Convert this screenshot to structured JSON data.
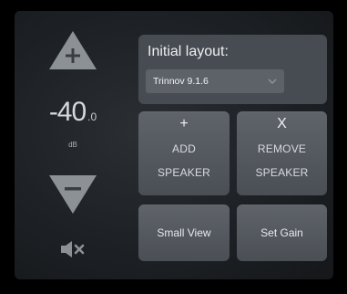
{
  "volume": {
    "value_main": "-40",
    "value_decimal": ".0",
    "unit": "dB",
    "up_icon": "triangle-up-plus-icon",
    "down_icon": "triangle-down-minus-icon",
    "mute_icon": "speaker-mute-icon"
  },
  "layout": {
    "title": "Initial layout:",
    "selected": "Trinnov 9.1.6",
    "dropdown_icon": "chevron-down-icon"
  },
  "buttons": {
    "add": {
      "symbol": "+",
      "line1": "ADD",
      "line2": "SPEAKER"
    },
    "remove": {
      "symbol": "X",
      "line1": "REMOVE",
      "line2": "SPEAKER"
    },
    "small_view": "Small View",
    "set_gain": "Set Gain"
  },
  "colors": {
    "panel": "#1d2125",
    "button": "#52575d",
    "triangle": "#8c9196",
    "text": "#e7e9eb"
  }
}
